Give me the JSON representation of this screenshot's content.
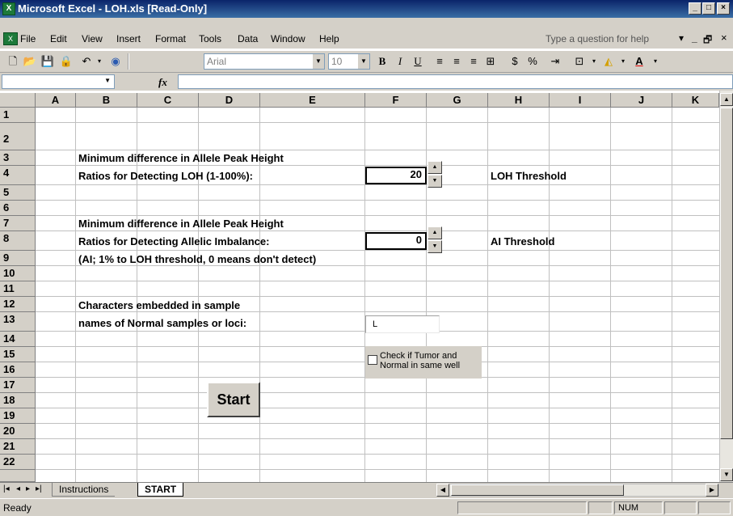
{
  "window": {
    "title": "Microsoft Excel - LOH.xls  [Read-Only]",
    "controls": [
      "_",
      "□",
      "×"
    ]
  },
  "menu": {
    "items": [
      "File",
      "Edit",
      "View",
      "Insert",
      "Format",
      "Tools",
      "Data",
      "Window",
      "Help"
    ],
    "help_search_placeholder": "Type a question for help",
    "window_controls": [
      "▾",
      "_",
      "🗗",
      "×"
    ]
  },
  "toolbar": {
    "font_name": "Arial",
    "font_size": "10",
    "bold": "B",
    "italic": "I",
    "underline": "U",
    "currency": "$",
    "percent": "%"
  },
  "formula_bar": {
    "fx_label": "fx",
    "name_box": "",
    "content": ""
  },
  "grid": {
    "columns": [
      "A",
      "B",
      "C",
      "D",
      "E",
      "F",
      "G",
      "H",
      "I",
      "J",
      "K"
    ],
    "rows": [
      "1",
      "2",
      "3",
      "4",
      "5",
      "6",
      "7",
      "8",
      "9",
      "10",
      "11",
      "12",
      "13",
      "14",
      "15",
      "16",
      "17",
      "18",
      "19",
      "20",
      "21",
      "22"
    ]
  },
  "content": {
    "loh_line1": "Minimum difference in Allele Peak Height",
    "loh_line2": "Ratios for Detecting LOH (1-100%):",
    "loh_value": "20",
    "loh_label": "LOH Threshold",
    "ai_line1": "Minimum difference in Allele Peak Height",
    "ai_line2": "Ratios for Detecting Allelic Imbalance:",
    "ai_line3": "(AI; 1% to LOH threshold, 0 means don't detect)",
    "ai_value": "0",
    "ai_label": "AI Threshold",
    "chars_line1": "Characters embedded in sample",
    "chars_line2": "names of Normal samples or loci:",
    "chars_value": "L",
    "checkbox_line1": "Check if Tumor and",
    "checkbox_line2": "Normal in same well",
    "checkbox_checked": false,
    "start_label": "Start"
  },
  "sheet_tabs": {
    "nav": [
      "|◂",
      "◂",
      "▸",
      "▸|"
    ],
    "tabs": [
      "Instructions",
      "START"
    ],
    "active": "START"
  },
  "status": {
    "left": "Ready",
    "num": "NUM"
  }
}
